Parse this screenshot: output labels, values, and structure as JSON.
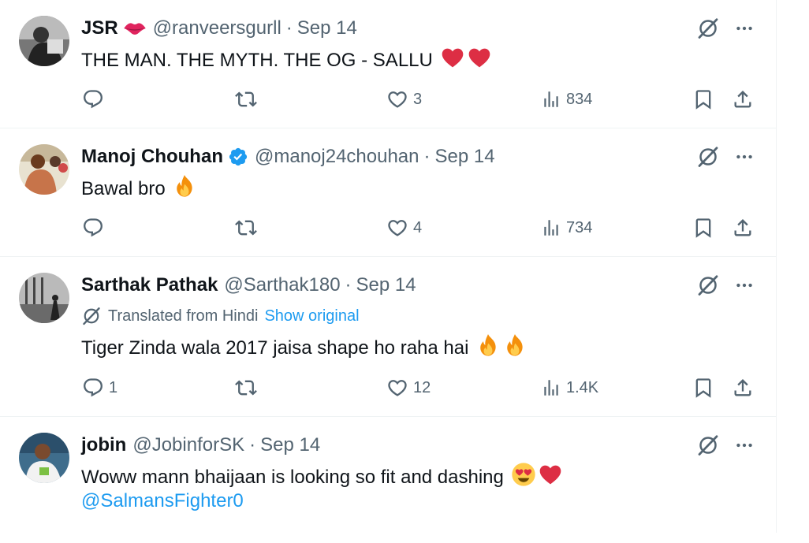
{
  "tweets": [
    {
      "display_name": "JSR",
      "handle": "@ranveersgurll",
      "dot": "·",
      "time": "Sep 14",
      "name_emoji": "kiss-mark-icon",
      "text": "THE MAN. THE MYTH. THE OG - SALLU",
      "text_emojis": [
        "red-heart-emoji",
        "red-heart-emoji"
      ],
      "stats": {
        "replies": "",
        "reposts": "",
        "likes": "3",
        "views": "834"
      }
    },
    {
      "display_name": "Manoj Chouhan",
      "verified": true,
      "handle": "@manoj24chouhan",
      "dot": "·",
      "time": "Sep 14",
      "text": "Bawal bro",
      "text_emojis": [
        "fire-emoji"
      ],
      "stats": {
        "replies": "",
        "reposts": "",
        "likes": "4",
        "views": "734"
      }
    },
    {
      "display_name": "Sarthak Pathak",
      "handle": "@Sarthak180",
      "dot": "·",
      "time": "Sep 14",
      "translated_label": "Translated from Hindi",
      "show_original": "Show original",
      "text": "Tiger Zinda wala 2017 jaisa shape ho raha hai",
      "text_emojis": [
        "fire-emoji",
        "fire-emoji"
      ],
      "stats": {
        "replies": "1",
        "reposts": "",
        "likes": "12",
        "views": "1.4K"
      }
    },
    {
      "display_name": "jobin",
      "handle": "@JobinforSK",
      "dot": "·",
      "time": "Sep 14",
      "text": "Woww mann bhaijaan is looking so fit and dashing",
      "text_emojis": [
        "heart-eyes-emoji",
        "red-heart-emoji"
      ],
      "mention": "@SalmansFighter0"
    }
  ],
  "colors": {
    "text_primary": "#0f1419",
    "text_secondary": "#536471",
    "link": "#1d9bf0",
    "verified": "#1d9bf0",
    "heart": "#e0245e",
    "divider": "#eff3f4"
  }
}
